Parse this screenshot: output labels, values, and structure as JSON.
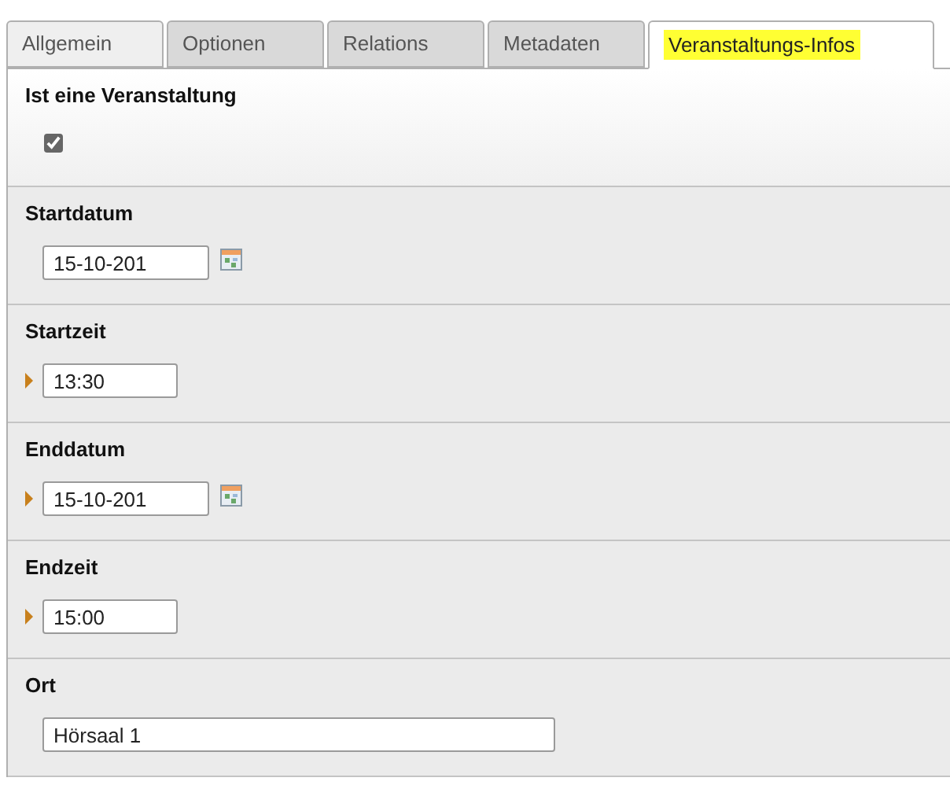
{
  "tabs": [
    {
      "label": "Allgemein",
      "selected": false
    },
    {
      "label": "Optionen",
      "selected": false
    },
    {
      "label": "Relations",
      "selected": false
    },
    {
      "label": "Metadaten",
      "selected": false
    },
    {
      "label": "Veranstaltungs-Infos",
      "selected": true
    }
  ],
  "fields": [
    {
      "kind": "checkbox",
      "label": "Ist eine Veranstaltung",
      "checked": true
    },
    {
      "kind": "date",
      "label": "Startdatum",
      "value": "15-10-201",
      "changed": false
    },
    {
      "kind": "time",
      "label": "Startzeit",
      "value": "13:30",
      "changed": true
    },
    {
      "kind": "date",
      "label": "Enddatum",
      "value": "15-10-201",
      "changed": true
    },
    {
      "kind": "time",
      "label": "Endzeit",
      "value": "15:00",
      "changed": true
    },
    {
      "kind": "text",
      "label": "Ort",
      "value": "Hörsaal 1",
      "changed": false
    }
  ]
}
